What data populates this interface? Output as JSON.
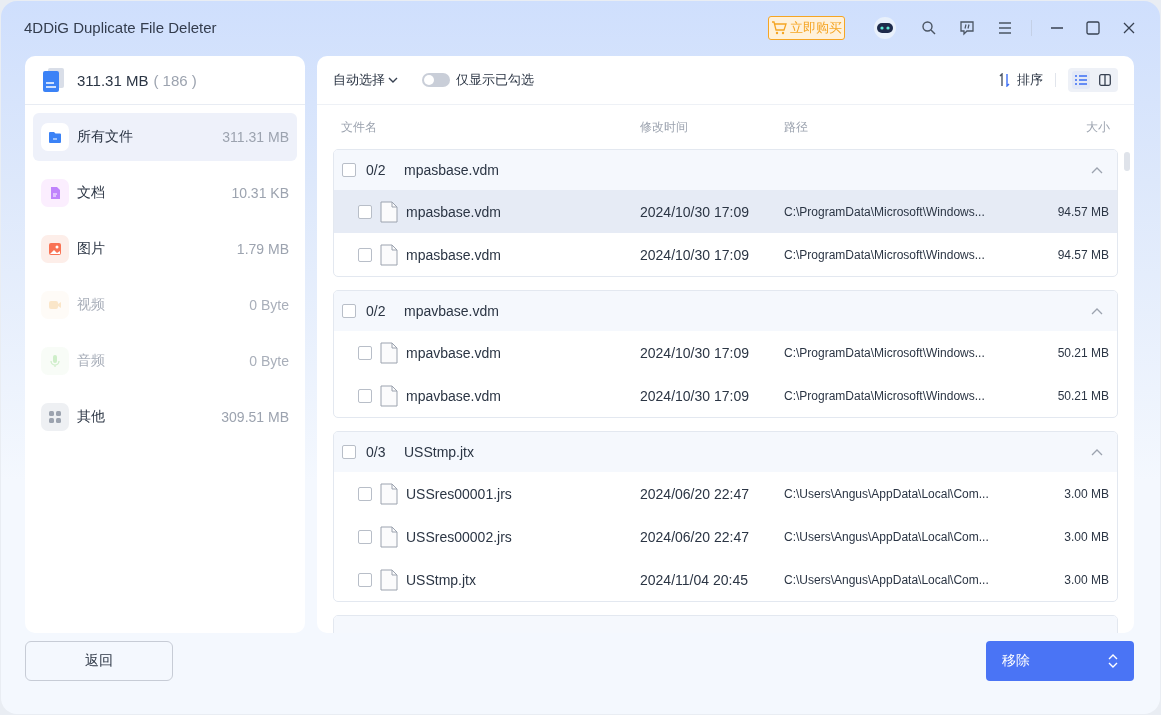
{
  "window": {
    "title": "4DDiG Duplicate File Deleter"
  },
  "title_bar": {
    "buy_label": "立即购买"
  },
  "sidebar": {
    "total_size": "311.31 MB",
    "total_count": "( 186 )",
    "items": [
      {
        "kind": "all",
        "label": "所有文件",
        "size": "311.31 MB",
        "selected": true,
        "disabled": false
      },
      {
        "kind": "doc",
        "label": "文档",
        "size": "10.31 KB",
        "selected": false,
        "disabled": false
      },
      {
        "kind": "image",
        "label": "图片",
        "size": "1.79 MB",
        "selected": false,
        "disabled": false
      },
      {
        "kind": "video",
        "label": "视频",
        "size": "0 Byte",
        "selected": false,
        "disabled": true
      },
      {
        "kind": "audio",
        "label": "音频",
        "size": "0 Byte",
        "selected": false,
        "disabled": true
      },
      {
        "kind": "other",
        "label": "其他",
        "size": "309.51 MB",
        "selected": false,
        "disabled": false
      }
    ]
  },
  "toolbar": {
    "auto_select": "自动选择",
    "show_checked_only": {
      "label": "仅显示已勾选",
      "on": false
    },
    "sort": "排序",
    "view_list_selected": true
  },
  "table": {
    "columns": [
      "文件名",
      "修改时间",
      "路径",
      "大小"
    ],
    "groups": [
      {
        "count": "0/2",
        "name": "mpasbase.vdm",
        "checked": false,
        "expanded": true,
        "files": [
          {
            "name": "mpasbase.vdm",
            "modified": "2024/10/30 17:09",
            "path": "C:\\ProgramData\\Microsoft\\Windows...",
            "size": "94.57 MB",
            "checked": false,
            "hovered": true
          },
          {
            "name": "mpasbase.vdm",
            "modified": "2024/10/30 17:09",
            "path": "C:\\ProgramData\\Microsoft\\Windows...",
            "size": "94.57 MB",
            "checked": false,
            "hovered": false
          }
        ]
      },
      {
        "count": "0/2",
        "name": "mpavbase.vdm",
        "checked": false,
        "expanded": true,
        "files": [
          {
            "name": "mpavbase.vdm",
            "modified": "2024/10/30 17:09",
            "path": "C:\\ProgramData\\Microsoft\\Windows...",
            "size": "50.21 MB",
            "checked": false,
            "hovered": false
          },
          {
            "name": "mpavbase.vdm",
            "modified": "2024/10/30 17:09",
            "path": "C:\\ProgramData\\Microsoft\\Windows...",
            "size": "50.21 MB",
            "checked": false,
            "hovered": false
          }
        ]
      },
      {
        "count": "0/3",
        "name": "USStmp.jtx",
        "checked": false,
        "expanded": true,
        "files": [
          {
            "name": "USSres00001.jrs",
            "modified": "2024/06/20 22:47",
            "path": "C:\\Users\\Angus\\AppData\\Local\\Com...",
            "size": "3.00 MB",
            "checked": false,
            "hovered": false
          },
          {
            "name": "USSres00002.jrs",
            "modified": "2024/06/20 22:47",
            "path": "C:\\Users\\Angus\\AppData\\Local\\Com...",
            "size": "3.00 MB",
            "checked": false,
            "hovered": false
          },
          {
            "name": "USStmp.jtx",
            "modified": "2024/11/04 20:45",
            "path": "C:\\Users\\Angus\\AppData\\Local\\Com...",
            "size": "3.00 MB",
            "checked": false,
            "hovered": false
          }
        ]
      }
    ]
  },
  "footer": {
    "back": "返回",
    "remove": "移除"
  }
}
